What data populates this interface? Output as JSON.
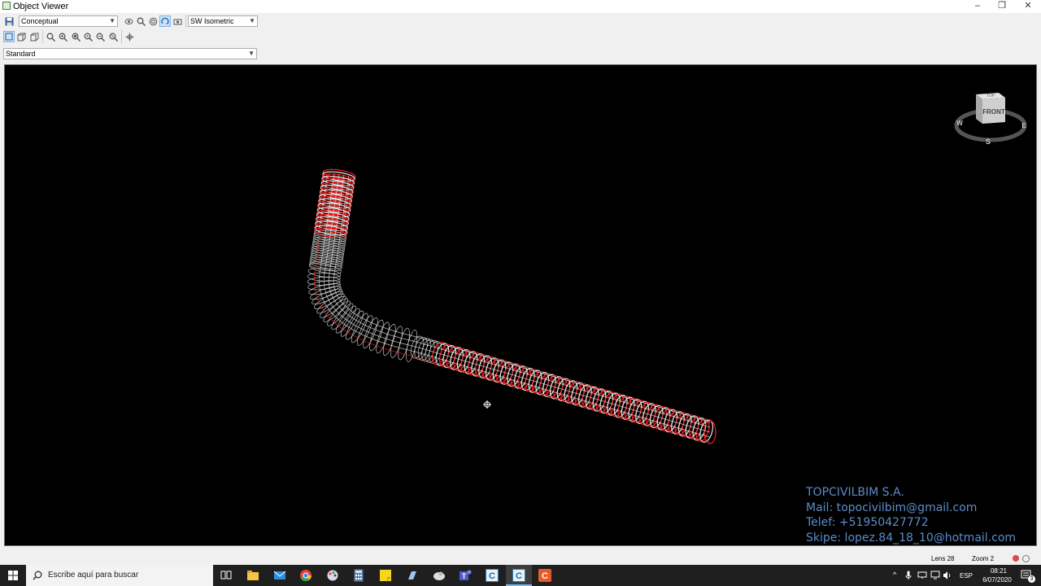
{
  "window": {
    "title": "Object Viewer"
  },
  "toolbar": {
    "visual_style": "Conceptual",
    "view_preset": "SW Isometric",
    "view_style": "Standard"
  },
  "viewcube": {
    "face": "FRONT",
    "top": "TOP",
    "west": "W",
    "east": "E",
    "south": "S"
  },
  "watermark": {
    "line1": "TOPCIVILBIM S.A.",
    "line2": "Mail: topocivilbim@gmail.com",
    "line3": "Telef: +51950427772",
    "line4": "Skipe: lopez.84_18_10@hotmail.com"
  },
  "status": {
    "lens": "Lens 28",
    "zoom": "Zoom 2"
  },
  "taskbar": {
    "search_placeholder": "Escribe aquí para buscar",
    "language": "ESP",
    "time": "08:21",
    "date": "6/07/2020",
    "notifications": "3"
  },
  "colors": {
    "tunnel_segment": "#ff1a1a",
    "mesh": "#e8e8e8",
    "viewport_bg": "#000000",
    "watermark": "#5b8dc9"
  }
}
